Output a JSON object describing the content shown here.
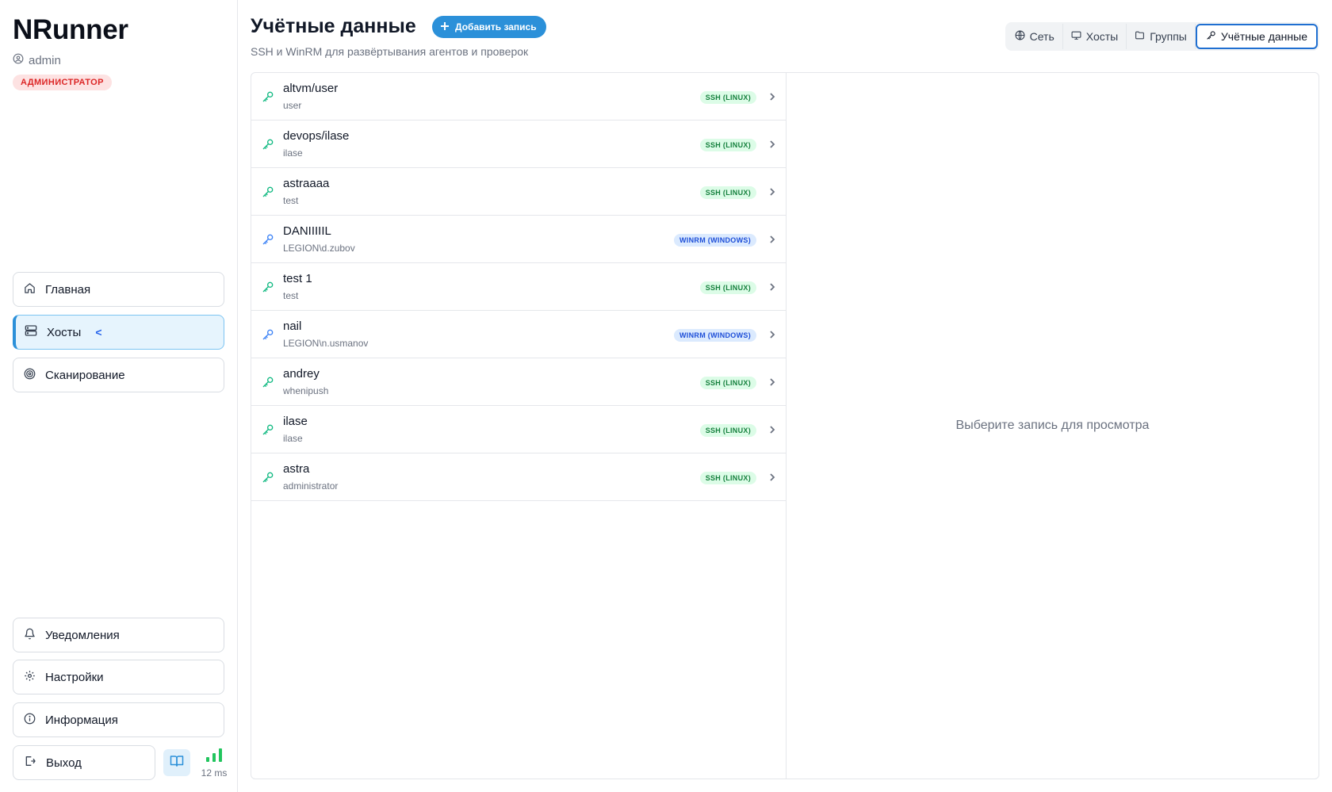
{
  "sidebar": {
    "brand": "NRunner",
    "user": "admin",
    "role": "АДМИНИСТРАТОР",
    "nav": [
      {
        "label": "Главная",
        "icon": "home-icon"
      },
      {
        "label": "Хосты",
        "icon": "server-icon",
        "active": true,
        "marker": "<"
      },
      {
        "label": "Сканирование",
        "icon": "target-icon"
      }
    ],
    "bottom": [
      {
        "label": "Уведомления",
        "icon": "bell-icon"
      },
      {
        "label": "Настройки",
        "icon": "gear-icon"
      },
      {
        "label": "Информация",
        "icon": "info-icon"
      }
    ],
    "exit_label": "Выход",
    "ping": "12 ms"
  },
  "header": {
    "title": "Учётные данные",
    "add_label": "Добавить запись",
    "subtitle": "SSH и WinRM для развёртывания агентов и проверок",
    "tabs": [
      {
        "label": "Сеть",
        "icon": "globe-icon"
      },
      {
        "label": "Хосты",
        "icon": "monitor-icon"
      },
      {
        "label": "Группы",
        "icon": "folder-icon"
      },
      {
        "label": "Учётные данные",
        "icon": "key-icon",
        "active": true
      }
    ]
  },
  "credentials": [
    {
      "name": "altvm/user",
      "login": "user",
      "type": "SSH (LINUX)",
      "kind": "ssh"
    },
    {
      "name": "devops/ilase",
      "login": "ilase",
      "type": "SSH (LINUX)",
      "kind": "ssh"
    },
    {
      "name": "astraaaa",
      "login": "test",
      "type": "SSH (LINUX)",
      "kind": "ssh"
    },
    {
      "name": "DANIIIIIL",
      "login": "LEGION\\d.zubov",
      "type": "WINRM (WINDOWS)",
      "kind": "winrm"
    },
    {
      "name": "test 1",
      "login": "test",
      "type": "SSH (LINUX)",
      "kind": "ssh"
    },
    {
      "name": "nail",
      "login": "LEGION\\n.usmanov",
      "type": "WINRM (WINDOWS)",
      "kind": "winrm"
    },
    {
      "name": "andrey",
      "login": "whenipush",
      "type": "SSH (LINUX)",
      "kind": "ssh"
    },
    {
      "name": "ilase",
      "login": "ilase",
      "type": "SSH (LINUX)",
      "kind": "ssh"
    },
    {
      "name": "astra",
      "login": "administrator",
      "type": "SSH (LINUX)",
      "kind": "ssh"
    }
  ],
  "details": {
    "empty_text": "Выберите запись для просмотра"
  },
  "colors": {
    "accent": "#2b90d9",
    "ssh_icon": "#10b981",
    "winrm_icon": "#3b82f6",
    "role_badge": "#dc2626"
  }
}
